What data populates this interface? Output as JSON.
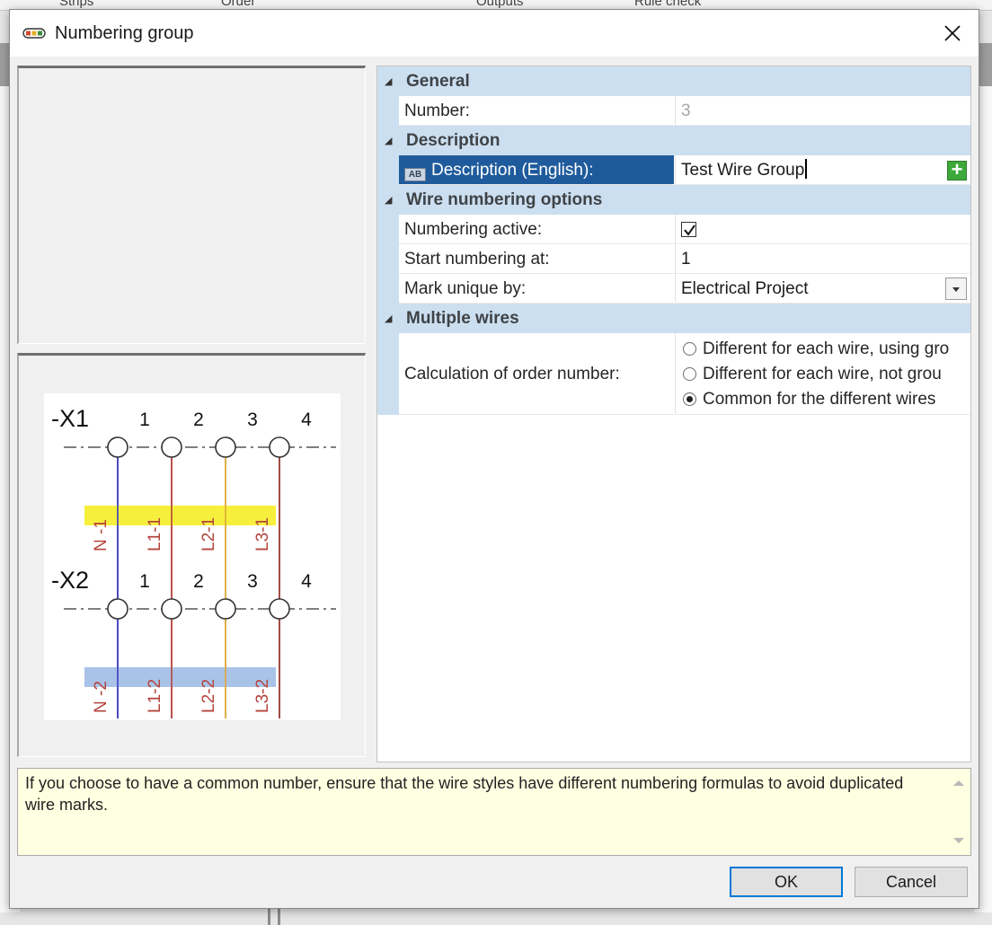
{
  "background": {
    "tabs": [
      "Strips",
      "Order",
      "Outputs",
      "Rule check"
    ]
  },
  "dialog": {
    "title": "Numbering group",
    "icon": "wire-group-icon",
    "close_icon": "close-icon"
  },
  "preview": {
    "terminals": [
      {
        "label": "-X1",
        "numbers": [
          "1",
          "2",
          "3",
          "4"
        ]
      },
      {
        "label": "-X2",
        "numbers": [
          "1",
          "2",
          "3",
          "4"
        ]
      }
    ],
    "marks_top": [
      "N -1",
      "L1-1",
      "L2-1",
      "L3-1"
    ],
    "marks_bottom": [
      "N -2",
      "L1-2",
      "L2-2",
      "L3-2"
    ],
    "wire_colors": [
      "#3b3bbd",
      "#b4443c",
      "#e0a83a",
      "#9a3d33"
    ],
    "mark_text_color": "#b4443c",
    "highlight_top": "#f6f03c",
    "highlight_bottom": "#a9c2e8"
  },
  "grid": {
    "general": {
      "label": "General",
      "number_label": "Number:",
      "number_value": "3"
    },
    "description": {
      "label": "Description",
      "desc_label": "Description (English):",
      "desc_icon_text": "AB",
      "desc_value": "Test Wire Group",
      "add_icon": "plus-icon"
    },
    "wire_numbering": {
      "label": "Wire numbering options",
      "numbering_active_label": "Numbering active:",
      "numbering_active": true,
      "start_label": "Start numbering at:",
      "start_value": "1",
      "mark_unique_label": "Mark unique by:",
      "mark_unique_value": "Electrical Project"
    },
    "multiple_wires": {
      "label": "Multiple wires",
      "calc_label": "Calculation of order number:",
      "options": [
        "Different for each wire, using gro",
        "Different for each wire, not grou",
        "Common for the different wires"
      ],
      "selected_index": 2
    }
  },
  "hint": {
    "text": "If you choose to have a common number, ensure that the wire styles have different numbering formulas to avoid duplicated wire marks."
  },
  "buttons": {
    "ok": "OK",
    "cancel": "Cancel"
  },
  "colors": {
    "category_bg": "#ccdff0",
    "selection": "#1f5b9c",
    "hint_bg": "#ffffe1",
    "accent_border": "#0078d7"
  }
}
